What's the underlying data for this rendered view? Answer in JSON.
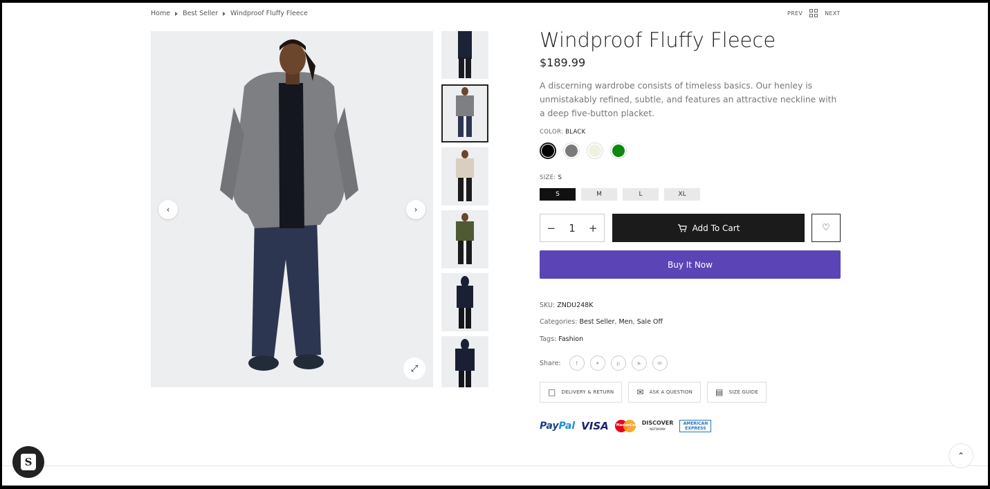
{
  "breadcrumb": {
    "home": "Home",
    "collection": "Best Seller",
    "current": "Windproof Fluffy Fleece"
  },
  "pager": {
    "prev": "PREV",
    "next": "NEXT"
  },
  "gallery": {
    "thumbnail_count": 6,
    "active_thumbnail": 2
  },
  "product": {
    "title": "Windproof Fluffy Fleece",
    "price": "$189.99",
    "description": "A discerning wardrobe consists of timeless basics. Our henley is unmistakably refined, subtle, and features an attractive neckline with a deep five-button placket.",
    "color_label": "COLOR:",
    "color_value": "BLACK",
    "colors": [
      {
        "name": "Black",
        "hex": "#000000",
        "selected": true
      },
      {
        "name": "Grey",
        "hex": "#7a7a7a",
        "selected": false
      },
      {
        "name": "Cream",
        "hex": "#f0f2e0",
        "selected": false
      },
      {
        "name": "Green",
        "hex": "#0d8a0d",
        "selected": false
      }
    ],
    "size_label": "SIZE:",
    "size_value": "S",
    "sizes": [
      "S",
      "M",
      "L",
      "XL"
    ],
    "quantity": "1",
    "add_to_cart": "Add To Cart",
    "buy_now": "Buy It Now",
    "sku_label": "SKU:",
    "sku": "ZNDU248K",
    "categories_label": "Categories:",
    "categories": [
      "Best Seller",
      "Men",
      "Sale Off"
    ],
    "tags_label": "Tags:",
    "tags": "Fashion",
    "share_label": "Share:"
  },
  "info_links": {
    "delivery": "DELIVERY & RETURN",
    "ask": "ASK A QUESTION",
    "size_guide": "SIZE GUIDE"
  },
  "payments": {
    "paypal_1": "Pay",
    "paypal_2": "Pal",
    "visa": "VISA",
    "mastercard": "MasterCard",
    "discover": "DISCOVER",
    "discover_sub": "NETWORK",
    "amex_1": "AMERICAN",
    "amex_2": "EXPRESS"
  },
  "colors": {
    "primary_dark": "#1b1b1b",
    "buy_now": "#5b45b6"
  }
}
